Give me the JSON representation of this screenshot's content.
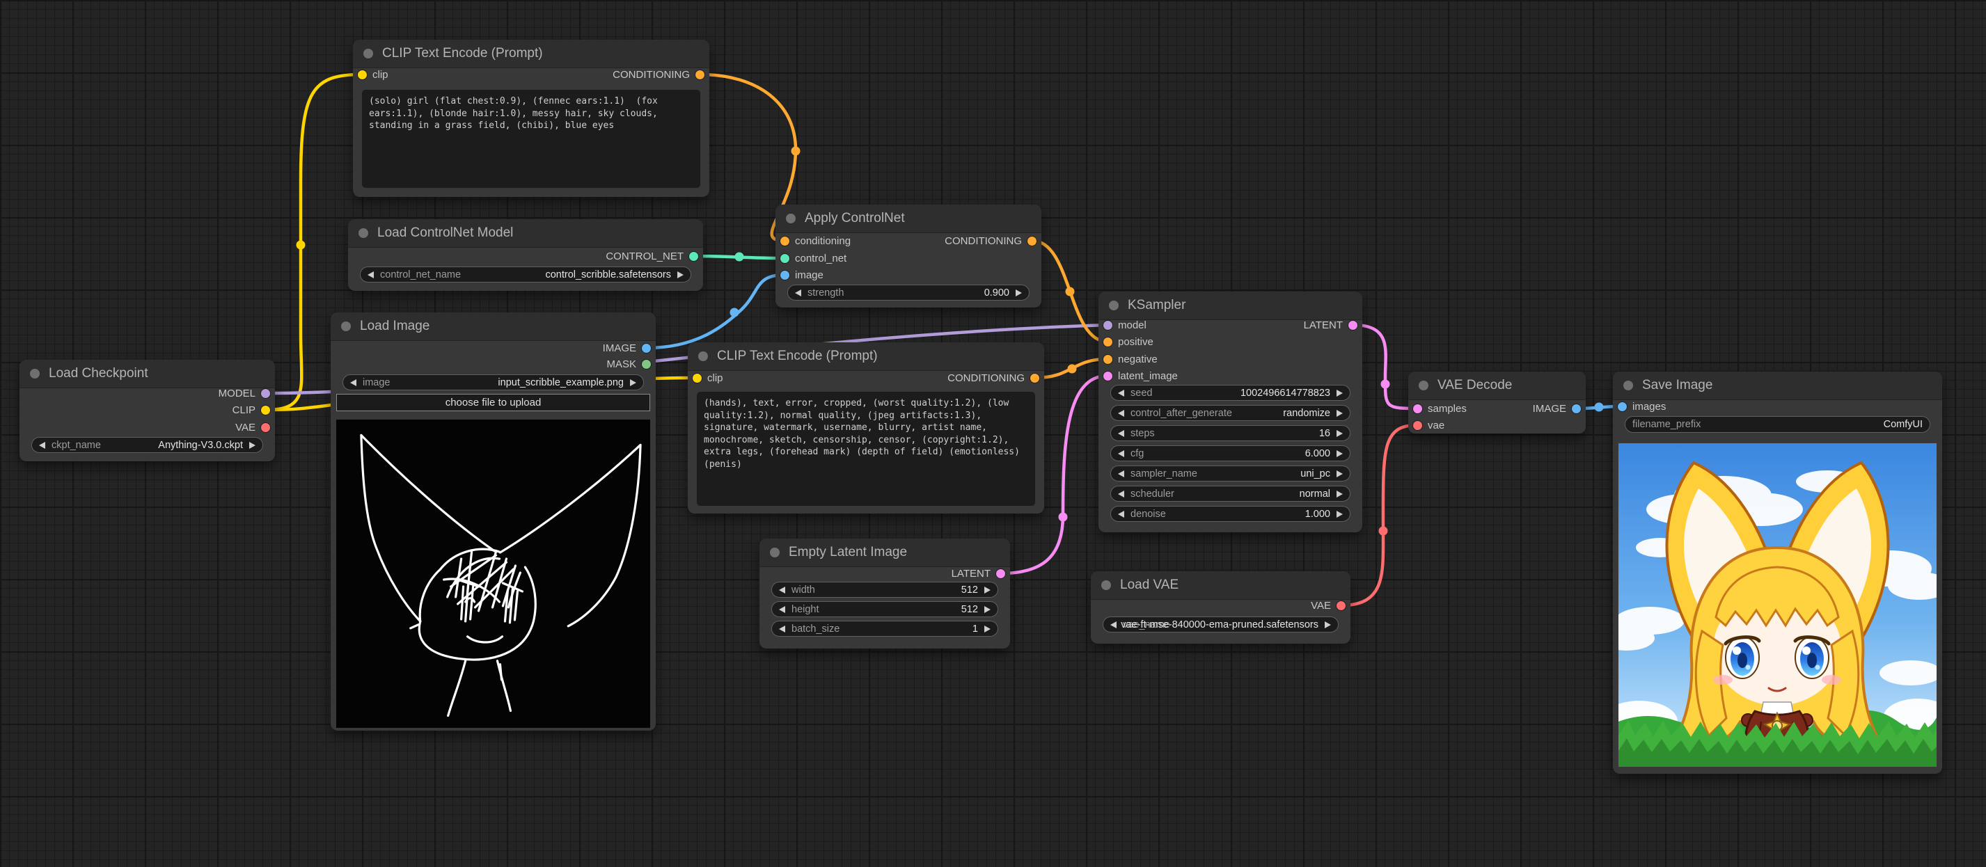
{
  "colors": {
    "model": "#B39DDB",
    "clip": "#FFD500",
    "vae": "#FF6E6E",
    "conditioning": "#FFA931",
    "control_net": "#5CE8B8",
    "image": "#64B5F6",
    "mask": "#81C784",
    "latent": "#F78DF2"
  },
  "nodes": {
    "load_checkpoint": {
      "title": "Load Checkpoint",
      "outputs": [
        "MODEL",
        "CLIP",
        "VAE"
      ],
      "widgets": [
        {
          "label": "ckpt_name",
          "value": "Anything-V3.0.ckpt"
        }
      ]
    },
    "clip_text_encode_positive": {
      "title": "CLIP Text Encode (Prompt)",
      "inputs": [
        "clip"
      ],
      "outputs": [
        "CONDITIONING"
      ],
      "text": "(solo) girl (flat chest:0.9), (fennec ears:1.1)  (fox ears:1.1), (blonde hair:1.0), messy hair, sky clouds, standing in a grass field, (chibi), blue eyes"
    },
    "load_controlnet": {
      "title": "Load ControlNet Model",
      "outputs": [
        "CONTROL_NET"
      ],
      "widgets": [
        {
          "label": "control_net_name",
          "value": "control_scribble.safetensors"
        }
      ]
    },
    "load_image": {
      "title": "Load Image",
      "outputs": [
        "IMAGE",
        "MASK"
      ],
      "widgets": [
        {
          "label": "image",
          "value": "input_scribble_example.png"
        }
      ],
      "button": "choose file to upload"
    },
    "apply_controlnet": {
      "title": "Apply ControlNet",
      "inputs": [
        "conditioning",
        "control_net",
        "image"
      ],
      "outputs": [
        "CONDITIONING"
      ],
      "widgets": [
        {
          "label": "strength",
          "value": "0.900"
        }
      ]
    },
    "clip_text_encode_negative": {
      "title": "CLIP Text Encode (Prompt)",
      "inputs": [
        "clip"
      ],
      "outputs": [
        "CONDITIONING"
      ],
      "text": "(hands), text, error, cropped, (worst quality:1.2), (low quality:1.2), normal quality, (jpeg artifacts:1.3), signature, watermark, username, blurry, artist name, monochrome, sketch, censorship, censor, (copyright:1.2), extra legs, (forehead mark) (depth of field) (emotionless) (penis)"
    },
    "empty_latent": {
      "title": "Empty Latent Image",
      "outputs": [
        "LATENT"
      ],
      "widgets": [
        {
          "label": "width",
          "value": "512"
        },
        {
          "label": "height",
          "value": "512"
        },
        {
          "label": "batch_size",
          "value": "1"
        }
      ]
    },
    "ksampler": {
      "title": "KSampler",
      "inputs": [
        "model",
        "positive",
        "negative",
        "latent_image"
      ],
      "outputs": [
        "LATENT"
      ],
      "widgets": [
        {
          "label": "seed",
          "value": "1002496614778823"
        },
        {
          "label": "control_after_generate",
          "value": "randomize"
        },
        {
          "label": "steps",
          "value": "16"
        },
        {
          "label": "cfg",
          "value": "6.000"
        },
        {
          "label": "sampler_name",
          "value": "uni_pc"
        },
        {
          "label": "scheduler",
          "value": "normal"
        },
        {
          "label": "denoise",
          "value": "1.000"
        }
      ]
    },
    "load_vae": {
      "title": "Load VAE",
      "outputs": [
        "VAE"
      ],
      "widgets": [
        {
          "label": "vae_name",
          "value": "vae-ft-mse-840000-ema-pruned.safetensors"
        }
      ]
    },
    "vae_decode": {
      "title": "VAE Decode",
      "inputs": [
        "samples",
        "vae"
      ],
      "outputs": [
        "IMAGE"
      ]
    },
    "save_image": {
      "title": "Save Image",
      "inputs": [
        "images"
      ],
      "widgets": [
        {
          "label": "filename_prefix",
          "value": "ComfyUI"
        }
      ]
    }
  }
}
